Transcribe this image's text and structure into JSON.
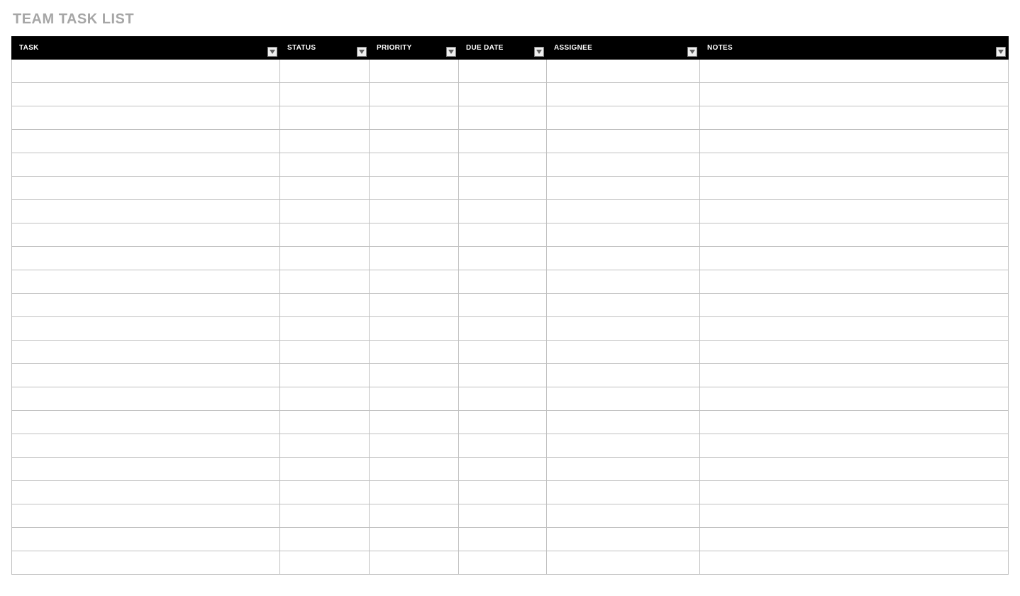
{
  "title": "TEAM TASK LIST",
  "columns": [
    {
      "key": "task",
      "label": "TASK"
    },
    {
      "key": "status",
      "label": "STATUS"
    },
    {
      "key": "priority",
      "label": "PRIORITY"
    },
    {
      "key": "duedate",
      "label": "DUE DATE"
    },
    {
      "key": "assignee",
      "label": "ASSIGNEE"
    },
    {
      "key": "notes",
      "label": "NOTES"
    }
  ],
  "rows": [
    {
      "task": "",
      "status": "",
      "priority": "",
      "duedate": "",
      "assignee": "",
      "notes": ""
    },
    {
      "task": "",
      "status": "",
      "priority": "",
      "duedate": "",
      "assignee": "",
      "notes": ""
    },
    {
      "task": "",
      "status": "",
      "priority": "",
      "duedate": "",
      "assignee": "",
      "notes": ""
    },
    {
      "task": "",
      "status": "",
      "priority": "",
      "duedate": "",
      "assignee": "",
      "notes": ""
    },
    {
      "task": "",
      "status": "",
      "priority": "",
      "duedate": "",
      "assignee": "",
      "notes": ""
    },
    {
      "task": "",
      "status": "",
      "priority": "",
      "duedate": "",
      "assignee": "",
      "notes": ""
    },
    {
      "task": "",
      "status": "",
      "priority": "",
      "duedate": "",
      "assignee": "",
      "notes": ""
    },
    {
      "task": "",
      "status": "",
      "priority": "",
      "duedate": "",
      "assignee": "",
      "notes": ""
    },
    {
      "task": "",
      "status": "",
      "priority": "",
      "duedate": "",
      "assignee": "",
      "notes": ""
    },
    {
      "task": "",
      "status": "",
      "priority": "",
      "duedate": "",
      "assignee": "",
      "notes": ""
    },
    {
      "task": "",
      "status": "",
      "priority": "",
      "duedate": "",
      "assignee": "",
      "notes": ""
    },
    {
      "task": "",
      "status": "",
      "priority": "",
      "duedate": "",
      "assignee": "",
      "notes": ""
    },
    {
      "task": "",
      "status": "",
      "priority": "",
      "duedate": "",
      "assignee": "",
      "notes": ""
    },
    {
      "task": "",
      "status": "",
      "priority": "",
      "duedate": "",
      "assignee": "",
      "notes": ""
    },
    {
      "task": "",
      "status": "",
      "priority": "",
      "duedate": "",
      "assignee": "",
      "notes": ""
    },
    {
      "task": "",
      "status": "",
      "priority": "",
      "duedate": "",
      "assignee": "",
      "notes": ""
    },
    {
      "task": "",
      "status": "",
      "priority": "",
      "duedate": "",
      "assignee": "",
      "notes": ""
    },
    {
      "task": "",
      "status": "",
      "priority": "",
      "duedate": "",
      "assignee": "",
      "notes": ""
    },
    {
      "task": "",
      "status": "",
      "priority": "",
      "duedate": "",
      "assignee": "",
      "notes": ""
    },
    {
      "task": "",
      "status": "",
      "priority": "",
      "duedate": "",
      "assignee": "",
      "notes": ""
    },
    {
      "task": "",
      "status": "",
      "priority": "",
      "duedate": "",
      "assignee": "",
      "notes": ""
    },
    {
      "task": "",
      "status": "",
      "priority": "",
      "duedate": "",
      "assignee": "",
      "notes": ""
    }
  ]
}
